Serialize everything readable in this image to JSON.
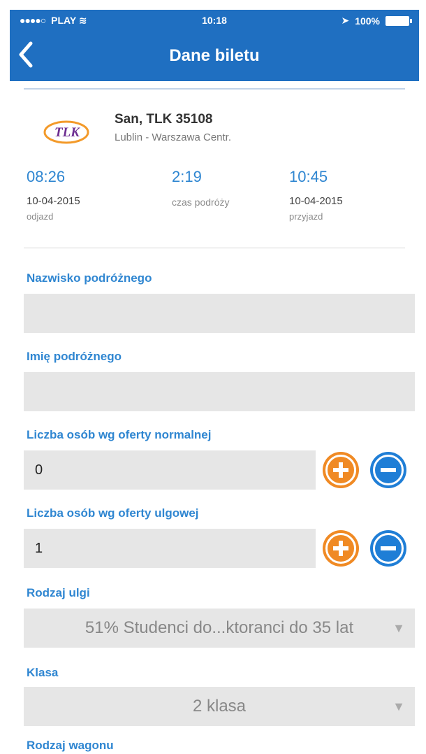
{
  "status_bar": {
    "carrier": "PLAY",
    "signal": "●●●●○",
    "time": "10:18",
    "battery_text": "100%"
  },
  "nav": {
    "title": "Dane biletu",
    "back_icon": "chevron-left-icon"
  },
  "train": {
    "logo_text": "TLK",
    "name": "San, TLK 35108",
    "route": "Lublin - Warszawa Centr."
  },
  "timing": {
    "departure": {
      "time": "08:26",
      "date": "10-04-2015",
      "label": "odjazd"
    },
    "duration": {
      "time": "2:19",
      "label": "czas podróży"
    },
    "arrival": {
      "time": "10:45",
      "date": "10-04-2015",
      "label": "przyjazd"
    }
  },
  "form": {
    "surname": {
      "label": "Nazwisko podróżnego",
      "value": ""
    },
    "first_name": {
      "label": "Imię podróżnego",
      "value": ""
    },
    "normal_count": {
      "label": "Liczba osób wg oferty normalnej",
      "value": "0"
    },
    "reduced_count": {
      "label": "Liczba osób wg oferty ulgowej",
      "value": "1"
    },
    "discount_type": {
      "label": "Rodzaj ulgi",
      "value": "51% Studenci do...ktoranci do 35 lat"
    },
    "class": {
      "label": "Klasa",
      "value": "2 klasa"
    },
    "car_type": {
      "label": "Rodzaj wagonu"
    }
  },
  "colors": {
    "header_blue": "#1f6fc1",
    "accent_blue": "#2f86d1",
    "plus_orange": "#f08a24",
    "minus_blue": "#1f7ed6",
    "field_gray": "#e6e6e6"
  }
}
